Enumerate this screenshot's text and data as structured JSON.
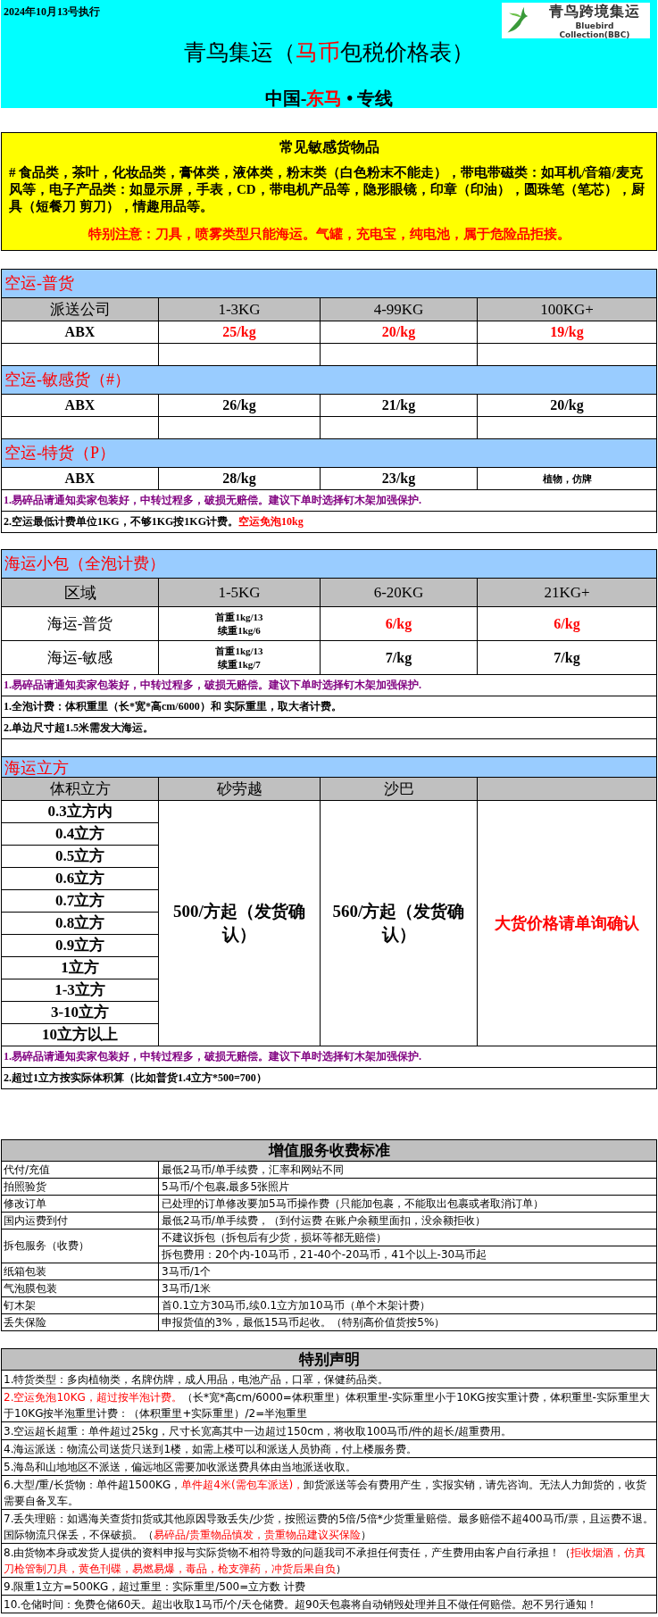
{
  "header": {
    "date": "2024年10月13号执行",
    "title": [
      {
        "text": "青鸟集运（",
        "highlight": false
      },
      {
        "text": "马币",
        "highlight": true
      },
      {
        "text": "包税价格表）",
        "highlight": false
      }
    ],
    "subtitle": [
      {
        "text": "中国-",
        "highlight": false
      },
      {
        "text": "东马",
        "highlight": true
      },
      {
        "text": " • 专线",
        "highlight": false
      }
    ],
    "logo": {
      "name": "青鸟跨境集运",
      "tagline": "Bluebird Collection(BBC)"
    }
  },
  "sensitive": {
    "title": "常见敏感货物品",
    "body": "# 食品类，茶叶，化妆品类，膏体类，液体类，粉末类（白色粉末不能走），带电带磁类：如耳机/音箱/麦克风等，电子产品类：如显示屏，手表，CD，带电机产品等，隐形眼镜，印章（印油），圆珠笔（笔芯），厨具（短餐刀 剪刀），情趣用品等。",
    "warning": "特别注意：刀具，喷雾类型只能海运。气罐，充电宝，纯电池，属于危险品拒接。"
  },
  "air": {
    "sections": [
      {
        "title": "空运-普货",
        "columns": [
          "派送公司",
          "1-3KG",
          "4-99KG",
          "100KG+"
        ],
        "rows": [
          {
            "cells": [
              {
                "kind": "text",
                "text": "ABX",
                "highlight": false
              },
              {
                "kind": "text",
                "text": "25/kg",
                "highlight": true
              },
              {
                "kind": "text",
                "text": "20/kg",
                "highlight": true
              },
              {
                "kind": "text",
                "text": "19/kg",
                "highlight": true
              }
            ]
          }
        ],
        "spacer_row": true
      },
      {
        "title": "空运-敏感货（#）",
        "rows": [
          {
            "cells": [
              {
                "kind": "text",
                "text": "ABX",
                "highlight": false
              },
              {
                "kind": "text",
                "text": "26/kg",
                "highlight": false
              },
              {
                "kind": "text",
                "text": "21/kg",
                "highlight": false
              },
              {
                "kind": "text",
                "text": "20/kg",
                "highlight": false
              }
            ]
          }
        ],
        "spacer_row": true
      },
      {
        "title": "空运-特货（P）",
        "rows": [
          {
            "cells": [
              {
                "kind": "text",
                "text": "ABX",
                "highlight": false
              },
              {
                "kind": "text",
                "text": "28/kg",
                "highlight": false
              },
              {
                "kind": "text",
                "text": "23/kg",
                "highlight": false
              },
              {
                "kind": "small",
                "text": "植物，仿牌",
                "highlight": false
              }
            ]
          }
        ],
        "spacer_row": false
      }
    ],
    "notes": [
      {
        "kind": "warning",
        "segments": [
          {
            "text": "1.易碎品请通知卖家包装好，中转过程多，破损无赔偿。建议下单时选择钉木架加强保护.",
            "highlight": false
          }
        ]
      },
      {
        "kind": "plain",
        "segments": [
          {
            "text": "2.空运最低计费单位1KG，不够1KG按1KG计费。",
            "highlight": false
          },
          {
            "text": "空运免泡10kg",
            "highlight": true
          }
        ]
      }
    ]
  },
  "sea_parcel": {
    "title": "海运小包（全泡计费）",
    "columns": [
      "区域",
      "1-5KG",
      "6-20KG",
      "21KG+"
    ],
    "rows": [
      {
        "cells": [
          {
            "kind": "text",
            "text": "海运-普货",
            "highlight": false
          },
          {
            "kind": "lines",
            "lines": [
              "首重1kg/13",
              "续重1kg/6"
            ],
            "highlight": false
          },
          {
            "kind": "text",
            "text": "6/kg",
            "highlight": true
          },
          {
            "kind": "text",
            "text": "6/kg",
            "highlight": true
          }
        ]
      },
      {
        "cells": [
          {
            "kind": "text",
            "text": "海运-敏感",
            "highlight": false
          },
          {
            "kind": "lines",
            "lines": [
              "首重1kg/13",
              "续重1kg/7"
            ],
            "highlight": false
          },
          {
            "kind": "text",
            "text": "7/kg",
            "highlight": false
          },
          {
            "kind": "text",
            "text": "7/kg",
            "highlight": false
          }
        ]
      }
    ],
    "notes": [
      {
        "kind": "warning",
        "segments": [
          {
            "text": "1.易碎品请通知卖家包装好，中转过程多，破损无赔偿。建议下单时选择钉木架加强保护.",
            "highlight": false
          }
        ]
      },
      {
        "kind": "plain",
        "segments": [
          {
            "text": "1.全泡计费：体积重里（长*宽*高cm/6000）和 实际重里，取大者计费。",
            "highlight": false
          }
        ]
      },
      {
        "kind": "plain",
        "segments": [
          {
            "text": "2.单边尺寸超1.5米需发大海运。",
            "highlight": false
          }
        ]
      }
    ],
    "spacer_row": true
  },
  "sea_cube": {
    "title": "海运立方",
    "columns": [
      "体积立方",
      "砂劳越",
      "沙巴"
    ],
    "volumes": [
      "0.3立方内",
      "0.4立方",
      "0.5立方",
      "0.6立方",
      "0.7立方",
      "0.8立方",
      "0.9立方",
      "1立方",
      "1-3立方",
      "3-10立方",
      "10立方以上"
    ],
    "prices": [
      {
        "text": "500/方起（发货确认）",
        "highlight": false
      },
      {
        "text": "560/方起（发货确认）",
        "highlight": false
      },
      {
        "text": "大货价格请单询确认",
        "highlight": true
      }
    ],
    "notes": [
      {
        "kind": "warning",
        "segments": [
          {
            "text": "1.易碎品请通知卖家包装好，中转过程多，破损无赔偿。建议下单时选择钉木架加强保护.",
            "highlight": false
          }
        ]
      },
      {
        "kind": "plain",
        "segments": [
          {
            "text": "2.超过1立方按实际体积算（比如普货1.4立方*500=700）",
            "highlight": false
          }
        ]
      }
    ]
  },
  "services": {
    "title": "增值服务收费标准",
    "rows": [
      {
        "name": "代付/充值",
        "details": [
          "最低2马币/单手续费，汇率和网站不同"
        ]
      },
      {
        "name": "拍照验货",
        "details": [
          "5马币/个包裹,最多5张照片"
        ]
      },
      {
        "name": "修改订单",
        "details": [
          "已处理的订单修改要加5马币操作费（只能加包裹，不能取出包裹或者取消订单）"
        ]
      },
      {
        "name": "国内运费到付",
        "details": [
          "最低2马币/单手续费，（到付运费 在账户余额里面扣，没余额拒收）"
        ]
      },
      {
        "name": "拆包服务（收费）",
        "details": [
          "不建议拆包（拆包后有少货，损坏等都无赔偿）",
          "拆包费用：20个内-10马币，21-40个-20马币，41个以上-30马币起"
        ]
      },
      {
        "name": "纸箱包装",
        "details": [
          "3马币/1个"
        ]
      },
      {
        "name": "气泡膜包装",
        "details": [
          "3马币/1米"
        ]
      },
      {
        "name": "钉木架",
        "details": [
          "首0.1立方30马币,续0.1立方加10马币（单个木架计费）"
        ]
      },
      {
        "name": "丢失保险",
        "details": [
          "申报货值的3%，最低15马币起收。（特别高价值货按5%）"
        ]
      }
    ]
  },
  "special": {
    "title": "特别声明",
    "items": [
      {
        "segments": [
          {
            "text": "1.特货类型：多肉植物类，名牌仿牌，成人用品，电池产品，口罩，保健药品类。",
            "highlight": false
          }
        ]
      },
      {
        "segments": [
          {
            "text": "2.空运免泡10KG，超过按半泡计费。",
            "highlight": true
          },
          {
            "text": "（长*宽*高cm/6000=体积重里）体积重里-实际重里小于10KG按实重计费，体积重里-实际重里大于10KG按半泡重里计费：（体积重里+实际重里）/2=半泡重里",
            "highlight": false
          }
        ]
      },
      {
        "segments": [
          {
            "text": "3.空运超长超重：单件超过25kg，尺寸长宽高其中一边超过150cm，将收取100马币/件的超长/超重费用。",
            "highlight": false
          }
        ]
      },
      {
        "segments": [
          {
            "text": "4.海运派送：物流公司送货只送到1楼，如需上楼可以和派送人员协商，付上楼服务费。",
            "highlight": false
          }
        ]
      },
      {
        "segments": [
          {
            "text": "5.海岛和山地地区不派送，偏远地区需要加收派送费具体由当地派送收取。",
            "highlight": false
          }
        ]
      },
      {
        "segments": [
          {
            "text": "6.大型/重/长货物：单件超1500KG，",
            "highlight": false
          },
          {
            "text": "单件超4米(需包车派送)，",
            "highlight": true
          },
          {
            "text": "卸货派送等会有费用产生，实报实销，请先咨询。无法人力卸货的，收货需要自备叉车。",
            "highlight": false
          }
        ]
      },
      {
        "segments": [
          {
            "text": "7.丢失理赔：如遇海关查货扣货或其他原因导致丢失/少货，按照运费的5倍/5倍*少货重量赔偿。最多赔偿不超400马币/票，且运费不退。国际物流只保丢，不保破损。（",
            "highlight": false
          },
          {
            "text": "易碎品/贵重物品慎发，贵重物品建议买保险",
            "highlight": true
          },
          {
            "text": "）",
            "highlight": false
          }
        ]
      },
      {
        "segments": [
          {
            "text": "8.由货物本身或发货人提供的资料申报与实际货物不相符导致的问题我司不承担任何责任，产生费用由客户自行承担！（",
            "highlight": false
          },
          {
            "text": "拒收烟酒，仿真刀枪管制刀具，黄色刊碟，易燃易爆，毒品，枪支弹药，冲货后果自负",
            "highlight": true
          },
          {
            "text": "）",
            "highlight": false
          }
        ]
      },
      {
        "segments": [
          {
            "text": "9.限重1立方=500KG，超过重里：实际重里/500=立方数 计费",
            "highlight": false
          }
        ]
      },
      {
        "segments": [
          {
            "text": "10.仓储时间：免费仓储60天。超出收取1马币/个/天仓储费。超90天包裹将自动销毁处理并且不做任何赔偿。恕不另行通知！",
            "highlight": false
          }
        ]
      }
    ]
  }
}
